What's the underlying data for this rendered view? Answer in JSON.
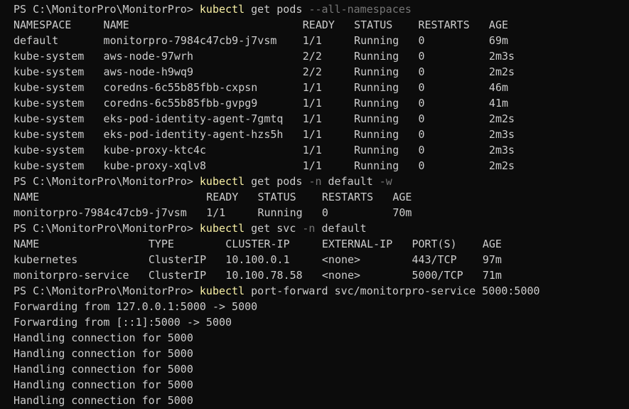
{
  "colors": {
    "background": "#0c0c0c",
    "text": "#cccccc",
    "command": "#f9f1a5",
    "flag": "#767676"
  },
  "prompt": "PS C:\\MonitorPro\\MonitorPro> ",
  "commands": [
    {
      "name": "kubectl",
      "args": [
        {
          "text": "get",
          "kind": "arg"
        },
        {
          "text": "pods",
          "kind": "arg"
        },
        {
          "text": "--all-namespaces",
          "kind": "flag"
        }
      ]
    },
    {
      "name": "kubectl",
      "args": [
        {
          "text": "get",
          "kind": "arg"
        },
        {
          "text": "pods",
          "kind": "arg"
        },
        {
          "text": "-n",
          "kind": "flag"
        },
        {
          "text": "default",
          "kind": "arg"
        },
        {
          "text": "-w",
          "kind": "flag"
        }
      ]
    },
    {
      "name": "kubectl",
      "args": [
        {
          "text": "get",
          "kind": "arg"
        },
        {
          "text": "svc",
          "kind": "arg"
        },
        {
          "text": "-n",
          "kind": "flag"
        },
        {
          "text": "default",
          "kind": "arg"
        }
      ]
    },
    {
      "name": "kubectl",
      "args": [
        {
          "text": "port-forward",
          "kind": "arg"
        },
        {
          "text": "svc/monitorpro-service",
          "kind": "arg"
        },
        {
          "text": "5000:5000",
          "kind": "arg"
        }
      ]
    }
  ],
  "all_pods_table": {
    "headers": [
      "NAMESPACE",
      "NAME",
      "READY",
      "STATUS",
      "RESTARTS",
      "AGE"
    ],
    "rows": [
      [
        "default",
        "monitorpro-7984c47cb9-j7vsm",
        "1/1",
        "Running",
        "0",
        "69m"
      ],
      [
        "kube-system",
        "aws-node-97wrh",
        "2/2",
        "Running",
        "0",
        "2m3s"
      ],
      [
        "kube-system",
        "aws-node-h9wq9",
        "2/2",
        "Running",
        "0",
        "2m2s"
      ],
      [
        "kube-system",
        "coredns-6c55b85fbb-cxpsn",
        "1/1",
        "Running",
        "0",
        "46m"
      ],
      [
        "kube-system",
        "coredns-6c55b85fbb-gvpg9",
        "1/1",
        "Running",
        "0",
        "41m"
      ],
      [
        "kube-system",
        "eks-pod-identity-agent-7gmtq",
        "1/1",
        "Running",
        "0",
        "2m2s"
      ],
      [
        "kube-system",
        "eks-pod-identity-agent-hzs5h",
        "1/1",
        "Running",
        "0",
        "2m3s"
      ],
      [
        "kube-system",
        "kube-proxy-ktc4c",
        "1/1",
        "Running",
        "0",
        "2m3s"
      ],
      [
        "kube-system",
        "kube-proxy-xqlv8",
        "1/1",
        "Running",
        "0",
        "2m2s"
      ]
    ]
  },
  "default_pods_table": {
    "headers": [
      "NAME",
      "READY",
      "STATUS",
      "RESTARTS",
      "AGE"
    ],
    "rows": [
      [
        "monitorpro-7984c47cb9-j7vsm",
        "1/1",
        "Running",
        "0",
        "70m"
      ]
    ]
  },
  "svc_table": {
    "headers": [
      "NAME",
      "TYPE",
      "CLUSTER-IP",
      "EXTERNAL-IP",
      "PORT(S)",
      "AGE"
    ],
    "rows": [
      [
        "kubernetes",
        "ClusterIP",
        "10.100.0.1",
        "<none>",
        "443/TCP",
        "97m"
      ],
      [
        "monitorpro-service",
        "ClusterIP",
        "10.100.78.58",
        "<none>",
        "5000/TCP",
        "71m"
      ]
    ]
  },
  "forward_output": [
    "Forwarding from 127.0.0.1:5000 -> 5000",
    "Forwarding from [::1]:5000 -> 5000",
    "Handling connection for 5000",
    "Handling connection for 5000",
    "Handling connection for 5000",
    "Handling connection for 5000",
    "Handling connection for 5000"
  ]
}
